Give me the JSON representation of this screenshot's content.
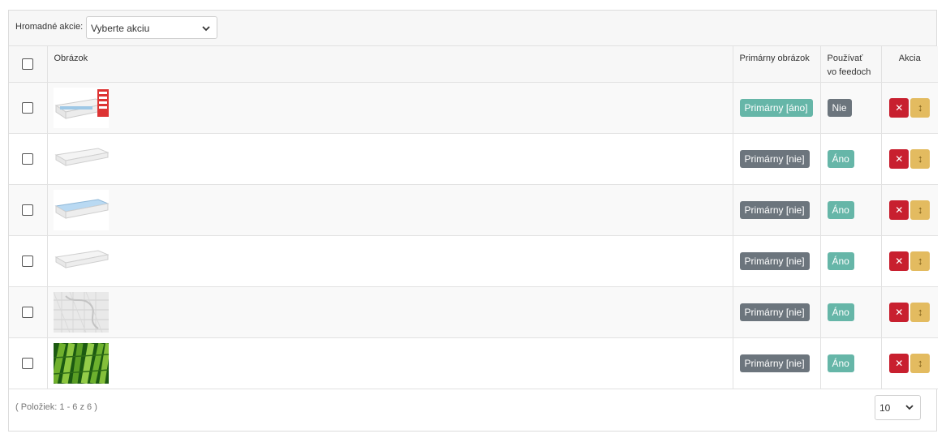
{
  "bulk": {
    "label": "Hromadné akcie:",
    "select_value": "Vyberte akciu"
  },
  "headers": {
    "image": "Obrázok",
    "primary": "Primárny obrázok",
    "feeds_line1": "Používať",
    "feeds_line2": "vo feedoch",
    "action": "Akcia"
  },
  "rows": [
    {
      "image": "mattress-with-labels",
      "primary": "Primárny [áno]",
      "feeds": "Nie"
    },
    {
      "image": "mattress-white",
      "primary": "Primárny [nie]",
      "feeds": "Áno"
    },
    {
      "image": "mattress-blue",
      "primary": "Primárny [nie]",
      "feeds": "Áno"
    },
    {
      "image": "mattress-white",
      "primary": "Primárny [nie]",
      "feeds": "Áno"
    },
    {
      "image": "quilted-fabric",
      "primary": "Primárny [nie]",
      "feeds": "Áno"
    },
    {
      "image": "bamboo",
      "primary": "Primárny [nie]",
      "feeds": "Áno"
    }
  ],
  "actions": {
    "delete_glyph": "✕",
    "move_glyph": "↕"
  },
  "footer": {
    "count_text": "( Položiek: 1 - 6 z 6 )",
    "page_size": "10"
  },
  "colors": {
    "grey_badge": "#6c757d",
    "teal_badge": "#66b6a8",
    "delete": "#c8202f",
    "move": "#e3bb60"
  }
}
